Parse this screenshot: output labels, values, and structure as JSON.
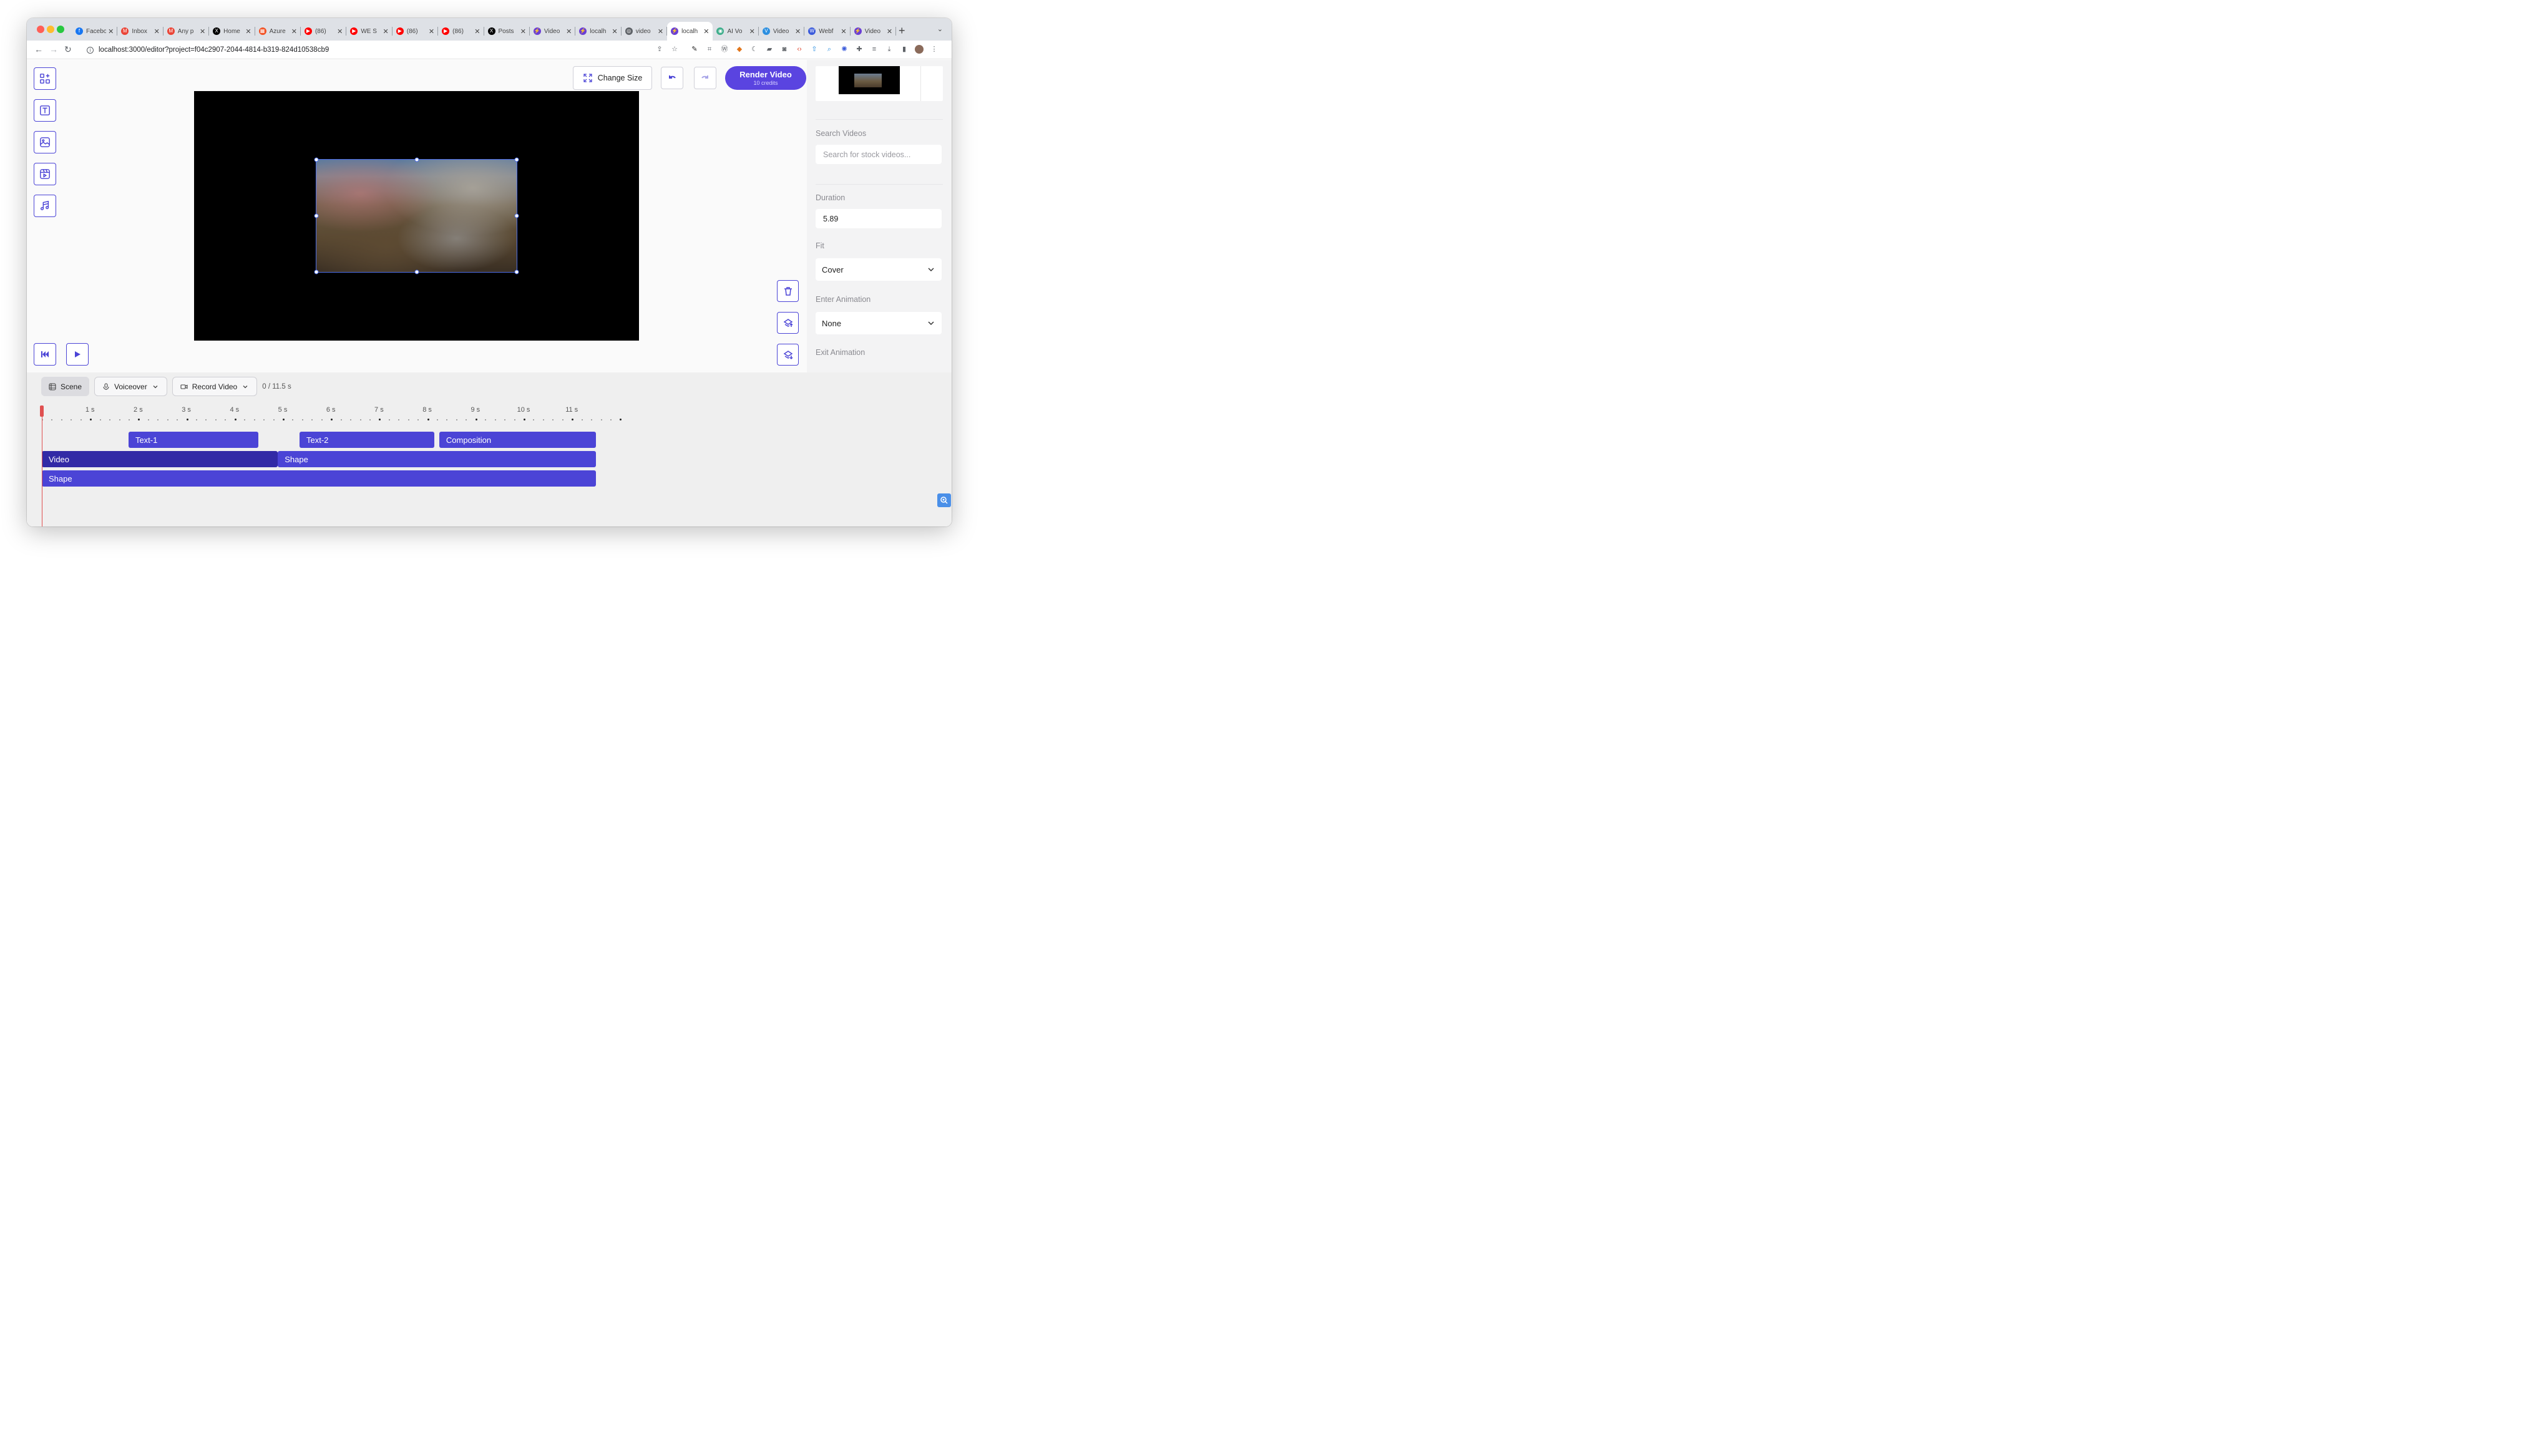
{
  "browser": {
    "tabs": [
      {
        "title": "Facebook",
        "icon_color": "#1877f2",
        "icon": "f"
      },
      {
        "title": "Inbox",
        "icon_color": "#ea4335",
        "icon": "M"
      },
      {
        "title": "Any p",
        "icon_color": "#ea4335",
        "icon": "M"
      },
      {
        "title": "Home",
        "icon_color": "#000000",
        "icon": "X"
      },
      {
        "title": "Azure",
        "icon_color": "#f25022",
        "icon": "▦"
      },
      {
        "title": "(86)",
        "icon_color": "#ff0000",
        "icon": "▶"
      },
      {
        "title": "WE S",
        "icon_color": "#ff0000",
        "icon": "▶"
      },
      {
        "title": "(86)",
        "icon_color": "#ff0000",
        "icon": "▶"
      },
      {
        "title": "(86)",
        "icon_color": "#ff0000",
        "icon": "▶"
      },
      {
        "title": "Posts",
        "icon_color": "#000000",
        "icon": "X"
      },
      {
        "title": "Video",
        "icon_color": "#6b3fd4",
        "icon": "⚡"
      },
      {
        "title": "localh",
        "icon_color": "#6b3fd4",
        "icon": "⚡"
      },
      {
        "title": "video",
        "icon_color": "#5f6368",
        "icon": "◎"
      },
      {
        "title": "localh",
        "icon_color": "#6b3fd4",
        "icon": "⚡",
        "active": true
      },
      {
        "title": "AI Vo",
        "icon_color": "#3fae8c",
        "icon": "◉"
      },
      {
        "title": "Video",
        "icon_color": "#2c8fe0",
        "icon": "V"
      },
      {
        "title": "Webf",
        "icon_color": "#3b5bdb",
        "icon": "W"
      },
      {
        "title": "Video",
        "icon_color": "#6b3fd4",
        "icon": "⚡"
      }
    ],
    "url": "localhost:3000/editor?project=f04c2907-2044-4814-b319-824d10538cb9"
  },
  "editor": {
    "change_size_label": "Change Size",
    "render_label": "Render Video",
    "render_credits": "10 credits"
  },
  "panel": {
    "search_label": "Search Videos",
    "search_placeholder": "Search for stock videos...",
    "duration_label": "Duration",
    "duration_value": "5.89",
    "fit_label": "Fit",
    "fit_value": "Cover",
    "enter_anim_label": "Enter Animation",
    "enter_anim_value": "None",
    "exit_anim_label": "Exit Animation"
  },
  "timeline": {
    "scene_label": "Scene",
    "voiceover_label": "Voiceover",
    "record_label": "Record Video",
    "time_display": "0 / 11.5 s",
    "ticks": [
      "1 s",
      "2 s",
      "3 s",
      "4 s",
      "5 s",
      "6 s",
      "7 s",
      "8 s",
      "9 s",
      "10 s",
      "11 s"
    ],
    "clips": [
      {
        "label": "Text-1",
        "track": 0,
        "start": 1.8,
        "end": 4.5
      },
      {
        "label": "Text-2",
        "track": 0,
        "start": 5.35,
        "end": 8.15
      },
      {
        "label": "Composition",
        "track": 0,
        "start": 8.25,
        "end": 11.5
      },
      {
        "label": "Video",
        "track": 1,
        "start": 0,
        "end": 4.9,
        "dark": true
      },
      {
        "label": "Shape",
        "track": 1,
        "start": 4.9,
        "end": 11.5
      },
      {
        "label": "Shape",
        "track": 2,
        "start": 0,
        "end": 11.5
      }
    ]
  },
  "colors": {
    "accent": "#4b44d6",
    "render_bg": "#5a44e0",
    "selected_clip": "#322aa6",
    "playhead": "#e05050"
  }
}
